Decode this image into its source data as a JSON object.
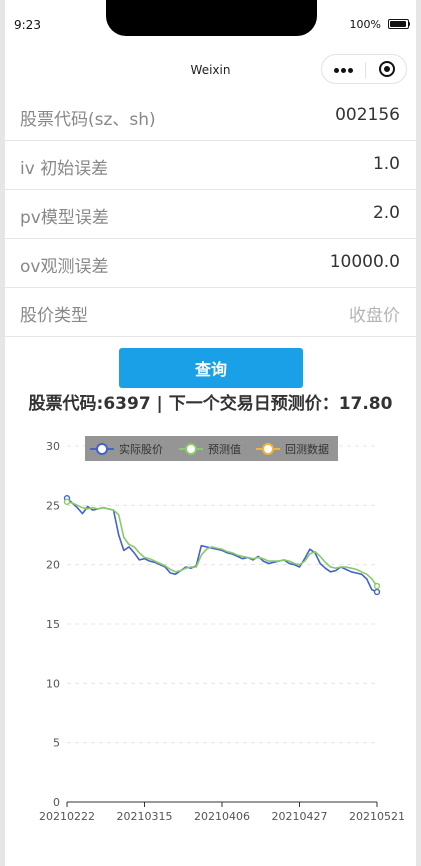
{
  "status_bar": {
    "time": "9:23",
    "battery": "100%"
  },
  "nav": {
    "title": "Weixin"
  },
  "form": {
    "rows": [
      {
        "label": "股票代码(sz、sh)",
        "value": "002156"
      },
      {
        "label": "iv 初始误差",
        "value": "1.0"
      },
      {
        "label": "pv模型误差",
        "value": "2.0"
      },
      {
        "label": "ov观测误差",
        "value": "10000.0"
      },
      {
        "label": "股价类型",
        "value": "收盘价"
      }
    ]
  },
  "query_button": "查询",
  "result_text": "股票代码:6397 | 下一个交易日预测价：17.80",
  "colors": {
    "accent": "#1aa0e6",
    "series_actual": "#4462c9",
    "series_pred": "#88c96a",
    "series_backtest": "#f4b23b"
  },
  "chart_data": {
    "type": "line",
    "x_tick_labels": [
      "20210222",
      "20210315",
      "20210406",
      "20210427",
      "20210521"
    ],
    "ylim": [
      0,
      30
    ],
    "y_ticks": [
      0,
      5,
      10,
      15,
      20,
      25,
      30
    ],
    "legend": {
      "position": "top",
      "items": [
        "实际股价",
        "预测值",
        "回测数据"
      ]
    },
    "grid": true,
    "x": [
      "20210222",
      "20210223",
      "20210224",
      "20210225",
      "20210226",
      "20210301",
      "20210302",
      "20210303",
      "20210304",
      "20210305",
      "20210308",
      "20210309",
      "20210310",
      "20210311",
      "20210312",
      "20210315",
      "20210316",
      "20210317",
      "20210318",
      "20210319",
      "20210322",
      "20210323",
      "20210324",
      "20210325",
      "20210326",
      "20210329",
      "20210330",
      "20210331",
      "20210401",
      "20210402",
      "20210406",
      "20210407",
      "20210408",
      "20210409",
      "20210412",
      "20210413",
      "20210414",
      "20210415",
      "20210416",
      "20210419",
      "20210420",
      "20210421",
      "20210422",
      "20210423",
      "20210426",
      "20210427",
      "20210428",
      "20210429",
      "20210430",
      "20210506",
      "20210507",
      "20210510",
      "20210511",
      "20210512",
      "20210513",
      "20210514",
      "20210517",
      "20210518",
      "20210519",
      "20210520",
      "20210521"
    ],
    "series": [
      {
        "name": "实际股价",
        "values": [
          25.6,
          25.2,
          24.8,
          24.3,
          24.9,
          24.6,
          24.7,
          24.8,
          24.7,
          24.6,
          22.5,
          21.2,
          21.5,
          21.0,
          20.4,
          20.5,
          20.3,
          20.2,
          20.0,
          19.8,
          19.3,
          19.2,
          19.5,
          19.8,
          19.7,
          19.9,
          21.6,
          21.5,
          21.4,
          21.3,
          21.2,
          21.0,
          20.9,
          20.7,
          20.5,
          20.6,
          20.4,
          20.7,
          20.3,
          20.1,
          20.2,
          20.3,
          20.4,
          20.1,
          20.0,
          19.8,
          20.5,
          21.3,
          21.0,
          20.1,
          19.7,
          19.4,
          19.5,
          19.8,
          19.6,
          19.4,
          19.3,
          19.2,
          18.8,
          17.9,
          17.7
        ]
      },
      {
        "name": "预测值",
        "values": [
          25.3,
          25.2,
          25.0,
          24.8,
          24.7,
          24.8,
          24.7,
          24.8,
          24.7,
          24.6,
          24.2,
          22.3,
          21.7,
          21.5,
          21.0,
          20.6,
          20.5,
          20.3,
          20.1,
          19.9,
          19.6,
          19.4,
          19.5,
          19.7,
          19.8,
          19.8,
          20.8,
          21.3,
          21.5,
          21.4,
          21.3,
          21.1,
          21.0,
          20.8,
          20.7,
          20.6,
          20.5,
          20.6,
          20.5,
          20.3,
          20.3,
          20.3,
          20.4,
          20.3,
          20.1,
          20.0,
          20.3,
          20.9,
          21.1,
          20.7,
          20.2,
          19.8,
          19.7,
          19.8,
          19.8,
          19.7,
          19.6,
          19.4,
          19.2,
          18.8,
          18.2
        ]
      },
      {
        "name": "回测数据",
        "values": []
      }
    ]
  }
}
